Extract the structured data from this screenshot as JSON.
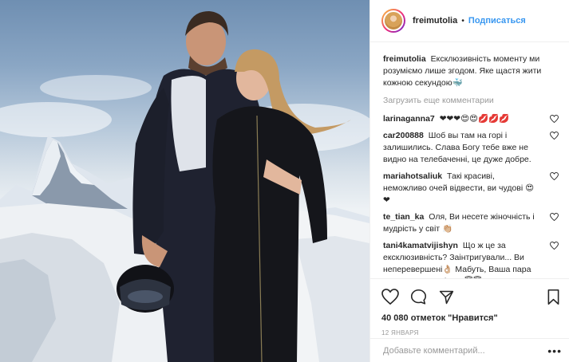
{
  "post": {
    "username": "freimutolia",
    "follow_label": "Подписаться",
    "separator": "•"
  },
  "caption": {
    "username": "freimutolia",
    "text": "Ексклюзивність моменту ми розуміємо лише згодом. Яке щастя жити кожною секундою🐳"
  },
  "load_more_label": "Загрузить еще комментарии",
  "comments": [
    {
      "username": "larinaganna7",
      "text": "❤❤❤😍😍💋💋💋"
    },
    {
      "username": "car200888",
      "text": "Шоб вы там на горі і залишились. Слава Богу тебе вже не видно на телебаченні, це дуже добре."
    },
    {
      "username": "mariahotsaliuk",
      "text": "Такі красиві, неможливо очей відвести, ви чудові 😍❤"
    },
    {
      "username": "te_tian_ka",
      "text": "Оля, Ви несете жіночність і мудрість у світ 👏🏼"
    },
    {
      "username": "tani4kamatvijishyn",
      "text": "Що ж це за ексклюзивність? Заінтригували... Ви неперевершені👌🏼 Мабуть, Ваша пара створена на небесах😇😇"
    }
  ],
  "likes_text": "40 080 отметок \"Нравится\"",
  "date_text": "12 января",
  "add_comment_placeholder": "Добавьте комментарий...",
  "more_label": "•••",
  "icons": {
    "like": "heart-icon",
    "comment": "comment-icon",
    "share": "share-icon",
    "save": "bookmark-icon",
    "comment_like": "heart-small-icon"
  },
  "colors": {
    "accent": "#3897f0",
    "muted": "#999999",
    "text": "#262626",
    "border": "#efefef"
  }
}
